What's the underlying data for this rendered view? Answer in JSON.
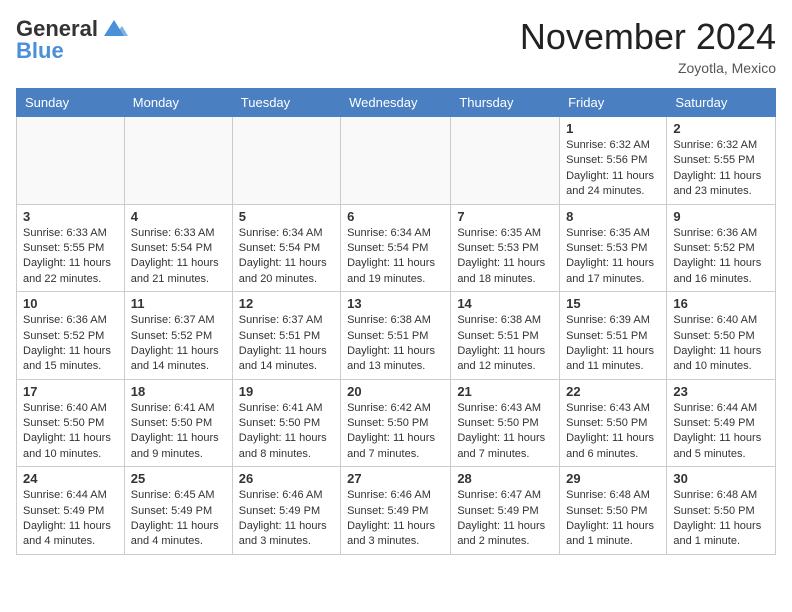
{
  "header": {
    "logo_general": "General",
    "logo_blue": "Blue",
    "month_title": "November 2024",
    "location": "Zoyotla, Mexico"
  },
  "weekdays": [
    "Sunday",
    "Monday",
    "Tuesday",
    "Wednesday",
    "Thursday",
    "Friday",
    "Saturday"
  ],
  "weeks": [
    [
      {
        "day": "",
        "info": "",
        "empty": true
      },
      {
        "day": "",
        "info": "",
        "empty": true
      },
      {
        "day": "",
        "info": "",
        "empty": true
      },
      {
        "day": "",
        "info": "",
        "empty": true
      },
      {
        "day": "",
        "info": "",
        "empty": true
      },
      {
        "day": "1",
        "info": "Sunrise: 6:32 AM\nSunset: 5:56 PM\nDaylight: 11 hours and 24 minutes."
      },
      {
        "day": "2",
        "info": "Sunrise: 6:32 AM\nSunset: 5:55 PM\nDaylight: 11 hours and 23 minutes."
      }
    ],
    [
      {
        "day": "3",
        "info": "Sunrise: 6:33 AM\nSunset: 5:55 PM\nDaylight: 11 hours and 22 minutes."
      },
      {
        "day": "4",
        "info": "Sunrise: 6:33 AM\nSunset: 5:54 PM\nDaylight: 11 hours and 21 minutes."
      },
      {
        "day": "5",
        "info": "Sunrise: 6:34 AM\nSunset: 5:54 PM\nDaylight: 11 hours and 20 minutes."
      },
      {
        "day": "6",
        "info": "Sunrise: 6:34 AM\nSunset: 5:54 PM\nDaylight: 11 hours and 19 minutes."
      },
      {
        "day": "7",
        "info": "Sunrise: 6:35 AM\nSunset: 5:53 PM\nDaylight: 11 hours and 18 minutes."
      },
      {
        "day": "8",
        "info": "Sunrise: 6:35 AM\nSunset: 5:53 PM\nDaylight: 11 hours and 17 minutes."
      },
      {
        "day": "9",
        "info": "Sunrise: 6:36 AM\nSunset: 5:52 PM\nDaylight: 11 hours and 16 minutes."
      }
    ],
    [
      {
        "day": "10",
        "info": "Sunrise: 6:36 AM\nSunset: 5:52 PM\nDaylight: 11 hours and 15 minutes."
      },
      {
        "day": "11",
        "info": "Sunrise: 6:37 AM\nSunset: 5:52 PM\nDaylight: 11 hours and 14 minutes."
      },
      {
        "day": "12",
        "info": "Sunrise: 6:37 AM\nSunset: 5:51 PM\nDaylight: 11 hours and 14 minutes."
      },
      {
        "day": "13",
        "info": "Sunrise: 6:38 AM\nSunset: 5:51 PM\nDaylight: 11 hours and 13 minutes."
      },
      {
        "day": "14",
        "info": "Sunrise: 6:38 AM\nSunset: 5:51 PM\nDaylight: 11 hours and 12 minutes."
      },
      {
        "day": "15",
        "info": "Sunrise: 6:39 AM\nSunset: 5:51 PM\nDaylight: 11 hours and 11 minutes."
      },
      {
        "day": "16",
        "info": "Sunrise: 6:40 AM\nSunset: 5:50 PM\nDaylight: 11 hours and 10 minutes."
      }
    ],
    [
      {
        "day": "17",
        "info": "Sunrise: 6:40 AM\nSunset: 5:50 PM\nDaylight: 11 hours and 10 minutes."
      },
      {
        "day": "18",
        "info": "Sunrise: 6:41 AM\nSunset: 5:50 PM\nDaylight: 11 hours and 9 minutes."
      },
      {
        "day": "19",
        "info": "Sunrise: 6:41 AM\nSunset: 5:50 PM\nDaylight: 11 hours and 8 minutes."
      },
      {
        "day": "20",
        "info": "Sunrise: 6:42 AM\nSunset: 5:50 PM\nDaylight: 11 hours and 7 minutes."
      },
      {
        "day": "21",
        "info": "Sunrise: 6:43 AM\nSunset: 5:50 PM\nDaylight: 11 hours and 7 minutes."
      },
      {
        "day": "22",
        "info": "Sunrise: 6:43 AM\nSunset: 5:50 PM\nDaylight: 11 hours and 6 minutes."
      },
      {
        "day": "23",
        "info": "Sunrise: 6:44 AM\nSunset: 5:49 PM\nDaylight: 11 hours and 5 minutes."
      }
    ],
    [
      {
        "day": "24",
        "info": "Sunrise: 6:44 AM\nSunset: 5:49 PM\nDaylight: 11 hours and 4 minutes."
      },
      {
        "day": "25",
        "info": "Sunrise: 6:45 AM\nSunset: 5:49 PM\nDaylight: 11 hours and 4 minutes."
      },
      {
        "day": "26",
        "info": "Sunrise: 6:46 AM\nSunset: 5:49 PM\nDaylight: 11 hours and 3 minutes."
      },
      {
        "day": "27",
        "info": "Sunrise: 6:46 AM\nSunset: 5:49 PM\nDaylight: 11 hours and 3 minutes."
      },
      {
        "day": "28",
        "info": "Sunrise: 6:47 AM\nSunset: 5:49 PM\nDaylight: 11 hours and 2 minutes."
      },
      {
        "day": "29",
        "info": "Sunrise: 6:48 AM\nSunset: 5:50 PM\nDaylight: 11 hours and 1 minute."
      },
      {
        "day": "30",
        "info": "Sunrise: 6:48 AM\nSunset: 5:50 PM\nDaylight: 11 hours and 1 minute."
      }
    ]
  ]
}
